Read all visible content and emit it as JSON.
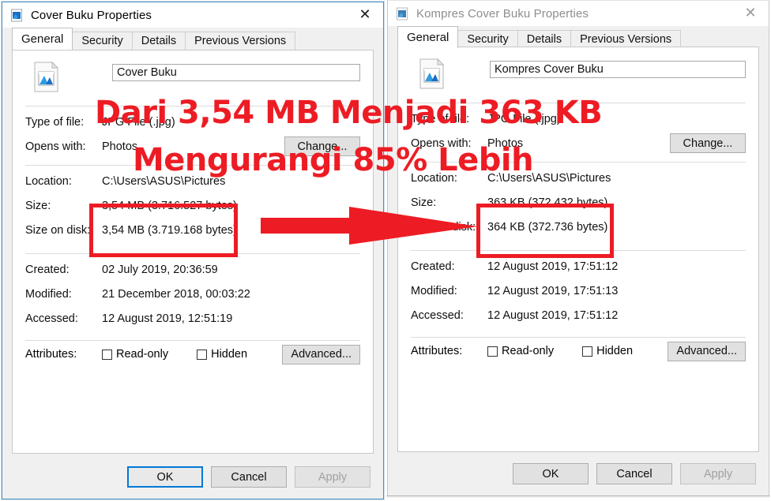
{
  "overlay": {
    "line1": "Dari 3,54 MB Menjadi 363 KB",
    "line2": "Mengurangi 85% Lebih",
    "accent_color": "#ed1c24",
    "arrow_name": "red-arrow-pointing-right"
  },
  "left_window": {
    "title": "Cover Buku Properties",
    "active": true,
    "close_glyph": "✕",
    "tabs": [
      {
        "label": "General",
        "active": true
      },
      {
        "label": "Security",
        "active": false
      },
      {
        "label": "Details",
        "active": false
      },
      {
        "label": "Previous Versions",
        "active": false
      }
    ],
    "file_name": "Cover Buku",
    "fields": {
      "type_label": "Type of file:",
      "type_value": "JPG File (.jpg)",
      "opens_label": "Opens with:",
      "opens_value": "Photos",
      "change_button": "Change...",
      "location_label": "Location:",
      "location_value": "C:\\Users\\ASUS\\Pictures",
      "size_label": "Size:",
      "size_value": "3,54 MB (3.716.527 bytes)",
      "size_disk_label": "Size on disk:",
      "size_disk_value": "3,54 MB (3.719.168 bytes)",
      "created_label": "Created:",
      "created_value": "02 July 2019, 20:36:59",
      "modified_label": "Modified:",
      "modified_value": "21 December 2018, 00:03:22",
      "accessed_label": "Accessed:",
      "accessed_value": "12 August 2019, 12:51:19",
      "attributes_label": "Attributes:",
      "readonly_label": "Read-only",
      "readonly_checked": false,
      "hidden_label": "Hidden",
      "hidden_checked": false,
      "advanced_button": "Advanced..."
    },
    "footer": {
      "ok": "OK",
      "cancel": "Cancel",
      "apply": "Apply",
      "apply_disabled": true,
      "ok_focused": true
    }
  },
  "right_window": {
    "title": "Kompres Cover Buku Properties",
    "active": false,
    "close_glyph": "✕",
    "tabs": [
      {
        "label": "General",
        "active": true
      },
      {
        "label": "Security",
        "active": false
      },
      {
        "label": "Details",
        "active": false
      },
      {
        "label": "Previous Versions",
        "active": false
      }
    ],
    "file_name": "Kompres Cover Buku",
    "fields": {
      "type_label": "Type of file:",
      "type_value": "JPG File (.jpg)",
      "opens_label": "Opens with:",
      "opens_value": "Photos",
      "change_button": "Change...",
      "location_label": "Location:",
      "location_value": "C:\\Users\\ASUS\\Pictures",
      "size_label": "Size:",
      "size_value": "363 KB (372.432 bytes)",
      "size_disk_label": "Size on disk:",
      "size_disk_value": "364 KB (372.736 bytes)",
      "created_label": "Created:",
      "created_value": "12 August 2019, 17:51:12",
      "modified_label": "Modified:",
      "modified_value": "12 August 2019, 17:51:13",
      "accessed_label": "Accessed:",
      "accessed_value": "12 August 2019, 17:51:12",
      "attributes_label": "Attributes:",
      "readonly_label": "Read-only",
      "readonly_checked": false,
      "hidden_label": "Hidden",
      "hidden_checked": false,
      "advanced_button": "Advanced..."
    },
    "footer": {
      "ok": "OK",
      "cancel": "Cancel",
      "apply": "Apply",
      "apply_disabled": true,
      "ok_focused": false
    }
  }
}
